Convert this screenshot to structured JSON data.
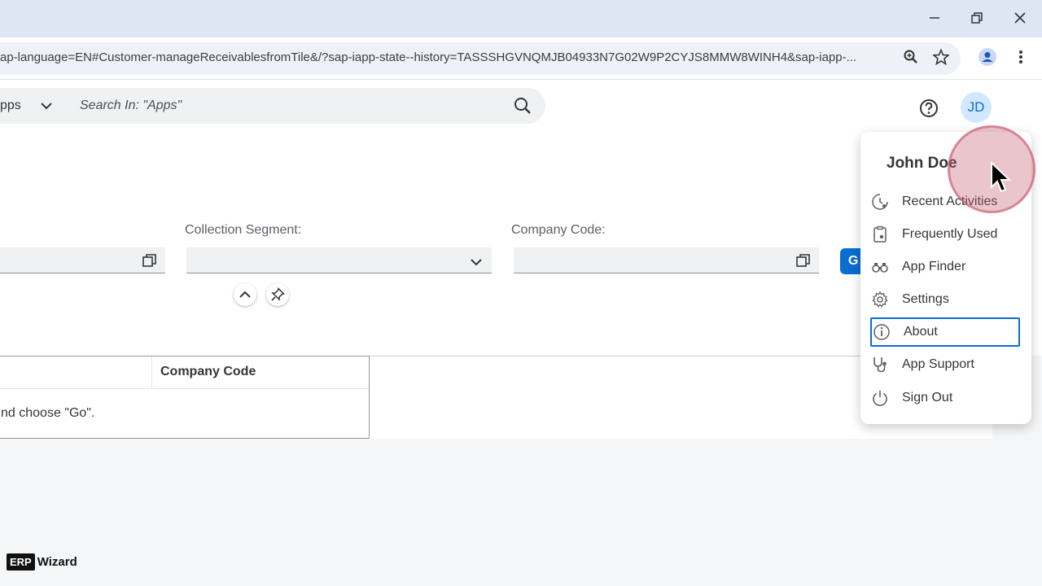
{
  "browser": {
    "url": "ap-language=EN#Customer-manageReceivablesfromTile&/?sap-iapp-state--history=TASSSHGVNQMJB04933N7G02W9P2CYJS8MMW8WINH4&sap-iapp-..."
  },
  "shell": {
    "apps_label": "pps",
    "search_placeholder": "Search In: \"Apps\"",
    "avatar_initials": "JD"
  },
  "filters": {
    "collection_segment_label": "Collection Segment:",
    "company_code_label": "Company Code:",
    "go_label": "G"
  },
  "table": {
    "column_header": "Company Code",
    "empty_message": "nd choose \"Go\"."
  },
  "user_menu": {
    "user_name": "John Doe",
    "items": [
      {
        "label": "Recent Activities",
        "icon": "recent-activities-icon"
      },
      {
        "label": "Frequently Used",
        "icon": "frequently-used-icon"
      },
      {
        "label": "App Finder",
        "icon": "app-finder-icon"
      },
      {
        "label": "Settings",
        "icon": "settings-icon"
      },
      {
        "label": "About",
        "icon": "info-icon"
      },
      {
        "label": "App Support",
        "icon": "stethoscope-icon"
      },
      {
        "label": "Sign Out",
        "icon": "power-icon"
      }
    ]
  },
  "watermark": {
    "logo_box": "ERP",
    "logo_text": "Wizard"
  },
  "colors": {
    "accent": "#0a6ed1",
    "avatar_bg": "#d1e8ff"
  }
}
